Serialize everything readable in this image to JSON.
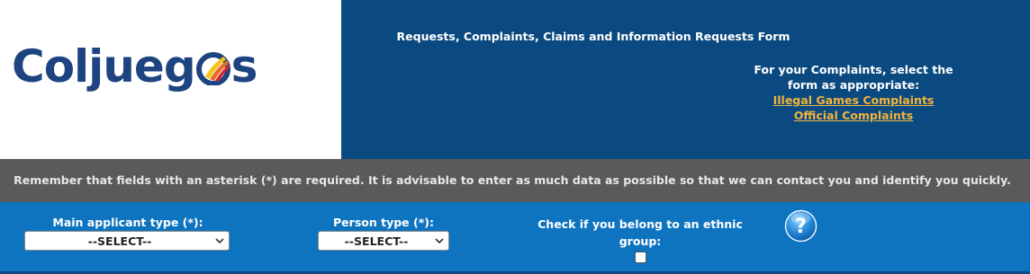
{
  "logo": {
    "text_before": "Coljueg",
    "text_after": "s",
    "alt": "Coljuegos"
  },
  "header": {
    "title": "Requests, Complaints, Claims and Information Requests Form",
    "complaints_intro_line1": "For your Complaints, select the",
    "complaints_intro_line2": "form as appropriate:",
    "links": [
      {
        "label": "Illegal Games Complaints"
      },
      {
        "label": "Official Complaints"
      }
    ],
    "link_color": "#f2b43c"
  },
  "notice": {
    "text": "Remember that fields with an asterisk (*) are required. It is advisable to enter as much data as possible so that we can contact you and identify you quickly."
  },
  "form": {
    "main_applicant_type": {
      "label": "Main applicant type (*):",
      "value": "--SELECT--"
    },
    "person_type": {
      "label": "Person type (*):",
      "value": "--SELECT--"
    },
    "ethnic_group": {
      "label_line1": "Check if you belong to an ethnic",
      "label_line2": "group:",
      "checked": false
    },
    "help_icon": "question-mark-icon"
  },
  "colors": {
    "header_bg": "#0b4a80",
    "notice_bg": "#5a5a5c",
    "form_bg": "#0f74bf",
    "logo_blue": "#1d4480"
  }
}
